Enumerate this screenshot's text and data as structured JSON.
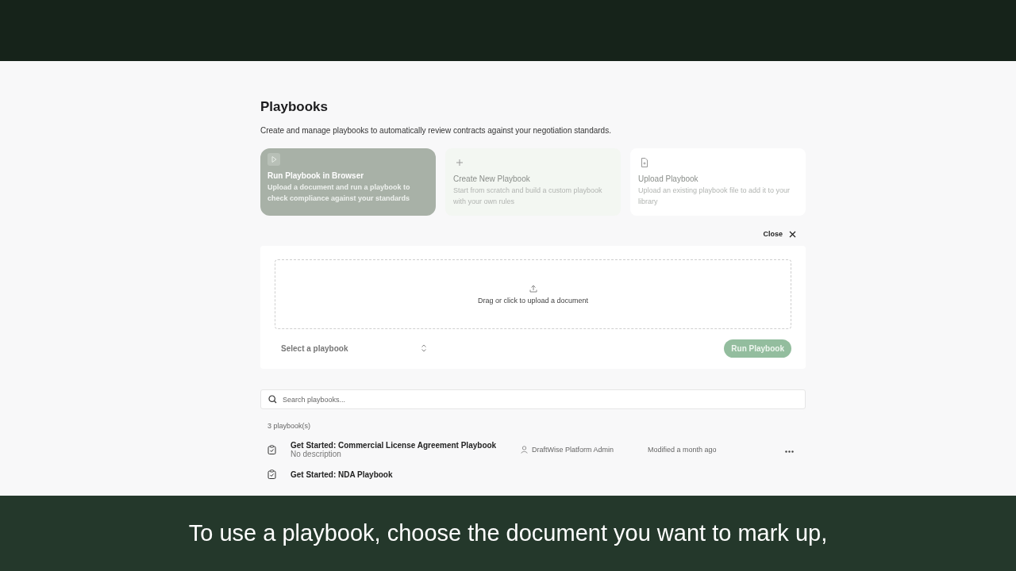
{
  "page": {
    "title": "Playbooks",
    "description": "Create and manage playbooks to automatically review contracts against your negotiation standards."
  },
  "actions": [
    {
      "kind": "run",
      "title": "Run Playbook in Browser",
      "description": "Upload a document and run a playbook to check compliance against your standards",
      "selected": true
    },
    {
      "kind": "create",
      "title": "Create New Playbook",
      "description": "Start from scratch and build a custom playbook with your own rules",
      "selected": false
    },
    {
      "kind": "upload",
      "title": "Upload Playbook",
      "description": "Upload an existing playbook file to add it to your library",
      "selected": false
    }
  ],
  "run_panel": {
    "close_label": "Close",
    "dropzone_text": "Drag or click to upload a document",
    "select_placeholder": "Select a playbook",
    "run_button": "Run Playbook"
  },
  "search": {
    "placeholder": "Search playbooks..."
  },
  "count": "3 playbook(s)",
  "playbooks": [
    {
      "title": "Get Started: Commercial License Agreement Playbook",
      "description": "No description",
      "author": "DraftWise Platform Admin",
      "modified": "Modified a month ago"
    },
    {
      "title": "Get Started: NDA Playbook"
    }
  ],
  "caption": "To use a playbook, choose the document you want to mark up,"
}
